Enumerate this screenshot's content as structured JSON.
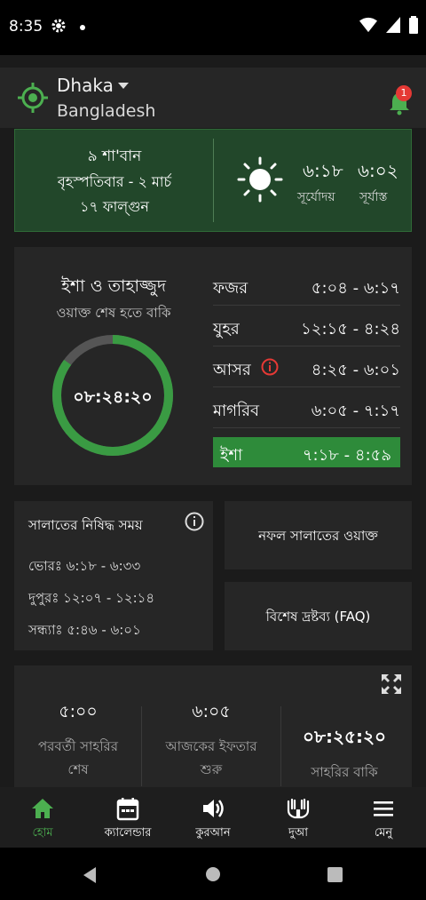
{
  "status_bar": {
    "time": "8:35"
  },
  "header": {
    "city": "Dhaka",
    "country": "Bangladesh",
    "notification_count": "1"
  },
  "date_card": {
    "hijri": "৯ শা'বান",
    "weekday_greg": "বৃহস্পতিবার - ২ মার্চ",
    "bangla": "১৭ ফাল্গুন",
    "sunrise_time": "৬:১৮",
    "sunset_time": "৬:০২",
    "sunrise_label": "সূর্যোদয়",
    "sunset_label": "সূর্যাস্ত"
  },
  "current_waqt": {
    "name": "ইশা ও তাহাজ্জুদ",
    "subtitle": "ওয়াক্ত শেষ হতে বাকি",
    "remaining": "০৮:২৪:২০",
    "progress_fraction": 0.85
  },
  "prayers": [
    {
      "name": "ফজর",
      "time": "৫:০৪ - ৬:১৭"
    },
    {
      "name": "যুহর",
      "time": "১২:১৫ - ৪:২৪"
    },
    {
      "name": "আসর",
      "time": "৪:২৫ - ৬:০১"
    },
    {
      "name": "মাগরিব",
      "time": "৬:০৫ - ৭:১৭"
    },
    {
      "name": "ইশা",
      "time": "৭:১৮ - ৪:৫৯"
    }
  ],
  "forbidden": {
    "title": "সালাতের নিষিদ্ধ সময়",
    "rows": [
      {
        "label": "ভোরঃ",
        "time": "৬:১৮ - ৬:৩৩"
      },
      {
        "label": "দুপুরঃ",
        "time": "১২:০৭ - ১২:১৪"
      },
      {
        "label": "সন্ধ্যাঃ",
        "time": "৫:৪৬ - ৬:০১"
      }
    ]
  },
  "nafl_button": "নফল সালাতের ওয়াক্ত",
  "faq_button": "বিশেষ দ্রষ্টব্য (FAQ)",
  "ramadan": {
    "sehri_end_time": "৫:০০",
    "sehri_end_label_1": "পরবর্তী সাহরির",
    "sehri_end_label_2": "শেষ",
    "iftar_time": "৬:০৫",
    "iftar_label_1": "আজকের ইফতার",
    "iftar_label_2": "শুরু",
    "sehri_remaining": "০৮:২৫:২০",
    "sehri_remaining_label": "সাহরির বাকি"
  },
  "nav": [
    {
      "label": "হোম",
      "icon": "home-icon"
    },
    {
      "label": "ক্যালেন্ডার",
      "icon": "calendar-icon"
    },
    {
      "label": "কুরআন",
      "icon": "speaker-icon"
    },
    {
      "label": "দুআ",
      "icon": "praying-hands-icon"
    },
    {
      "label": "মেনু",
      "icon": "menu-icon"
    }
  ],
  "colors": {
    "accent": "#4caf50",
    "date_card_bg": "#22472a",
    "active_prayer": "#2e8b3a",
    "alert": "#e53935"
  }
}
